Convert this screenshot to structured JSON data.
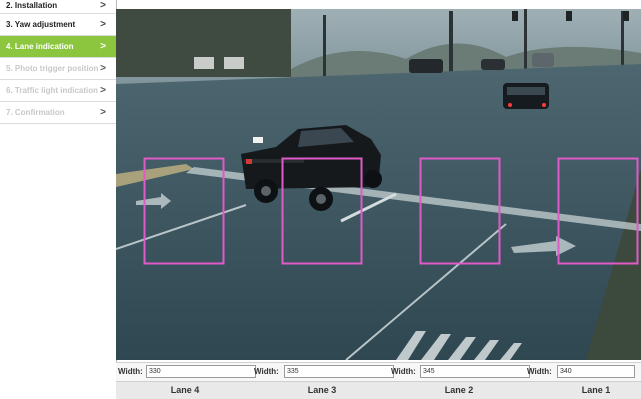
{
  "steps": [
    {
      "label": "2. Installation",
      "state": "done"
    },
    {
      "label": "3. Yaw adjustment",
      "state": "done"
    },
    {
      "label": "4. Lane indication",
      "state": "active"
    },
    {
      "label": "5. Photo trigger position",
      "state": "disabled"
    },
    {
      "label": "6. Traffic light indication",
      "state": "disabled"
    },
    {
      "label": "7. Confirmation",
      "state": "disabled"
    }
  ],
  "chevron": ">",
  "width_label": "Width:",
  "lanes": [
    {
      "name": "Lane 4",
      "width": "330"
    },
    {
      "name": "Lane 3",
      "width": "335"
    },
    {
      "name": "Lane 2",
      "width": "345"
    },
    {
      "name": "Lane 1",
      "width": "340"
    }
  ],
  "colors": {
    "accent": "#8cc63f",
    "lane_box": "#e05ac8"
  },
  "icons": [
    "chevron-right-icon"
  ]
}
